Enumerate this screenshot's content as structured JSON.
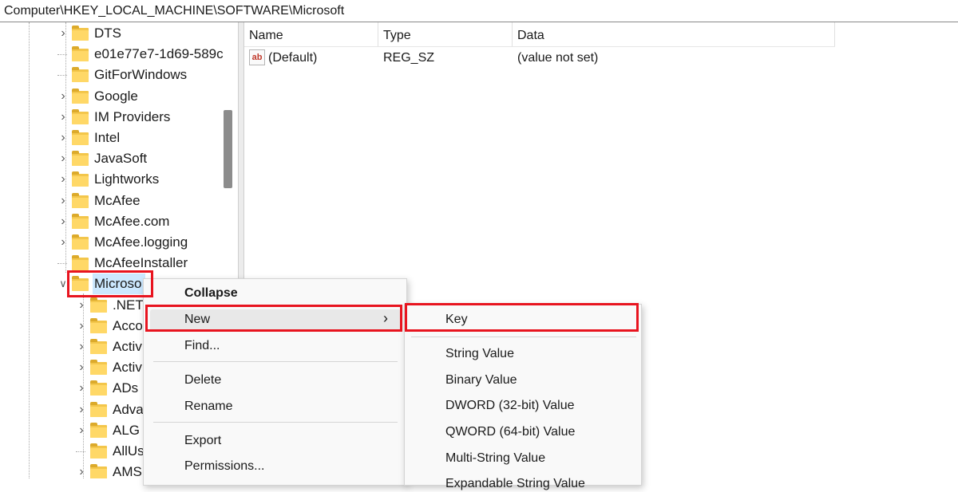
{
  "address_bar": {
    "path": "Computer\\HKEY_LOCAL_MACHINE\\SOFTWARE\\Microsoft"
  },
  "tree": {
    "parent_items": [
      {
        "label": "DTS",
        "expandable": true
      },
      {
        "label": "e01e77e7-1d69-589c",
        "expandable": false
      },
      {
        "label": "GitForWindows",
        "expandable": false
      },
      {
        "label": "Google",
        "expandable": true
      },
      {
        "label": "IM Providers",
        "expandable": true
      },
      {
        "label": "Intel",
        "expandable": true
      },
      {
        "label": "JavaSoft",
        "expandable": true
      },
      {
        "label": "Lightworks",
        "expandable": true
      },
      {
        "label": "McAfee",
        "expandable": true
      },
      {
        "label": "McAfee.com",
        "expandable": true
      },
      {
        "label": "McAfee.logging",
        "expandable": true
      },
      {
        "label": "McAfeeInstaller",
        "expandable": false
      }
    ],
    "selected_item": {
      "label": "Microso",
      "expanded": true
    },
    "child_items": [
      {
        "label": ".NETF",
        "expandable": true
      },
      {
        "label": "Acco",
        "expandable": true
      },
      {
        "label": "Activ",
        "expandable": true
      },
      {
        "label": "Activ",
        "expandable": true
      },
      {
        "label": "ADs",
        "expandable": true
      },
      {
        "label": "Adva",
        "expandable": true
      },
      {
        "label": "ALG",
        "expandable": true
      },
      {
        "label": "AllUs",
        "expandable": false
      },
      {
        "label": "AMS",
        "expandable": true
      }
    ]
  },
  "values_list": {
    "columns": {
      "name": "Name",
      "type": "Type",
      "data": "Data"
    },
    "rows": [
      {
        "icon": "string-value-icon",
        "icon_text": "ab",
        "name": "(Default)",
        "type": "REG_SZ",
        "data": "(value not set)"
      }
    ]
  },
  "context_menu": {
    "items": {
      "collapse": "Collapse",
      "new": "New",
      "new_arrow": "›",
      "find": "Find...",
      "delete": "Delete",
      "rename": "Rename",
      "export": "Export",
      "permissions": "Permissions..."
    }
  },
  "submenu": {
    "items": {
      "key": "Key",
      "string_value": "String Value",
      "binary_value": "Binary Value",
      "dword_value": "DWORD (32-bit) Value",
      "qword_value": "QWORD (64-bit) Value",
      "multi_string_value": "Multi-String Value",
      "expandable_string_value": "Expandable String Value"
    }
  },
  "colors": {
    "highlight_box": "#e8141f",
    "folder": "#ffd867",
    "selection": "#cce8ff"
  }
}
